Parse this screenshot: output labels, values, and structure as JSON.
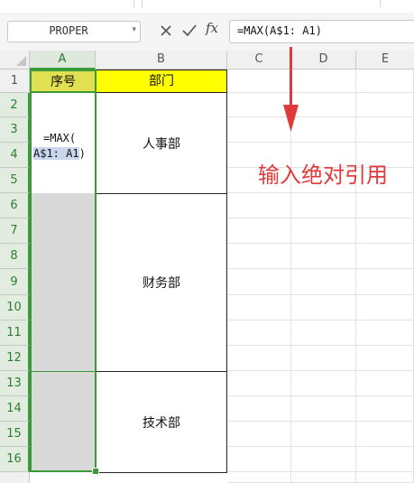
{
  "formula_bar": {
    "name_box": "PROPER",
    "name_box_arrow": "▾",
    "cancel_icon": "close-icon",
    "enter_icon": "check-icon",
    "fx_label": "fx",
    "formula": "=MAX(A$1: A1)"
  },
  "columns": [
    "A",
    "B",
    "C",
    "D",
    "E"
  ],
  "rows": [
    "1",
    "2",
    "3",
    "4",
    "5",
    "6",
    "7",
    "8",
    "9",
    "10",
    "11",
    "12",
    "13",
    "14",
    "15",
    "16"
  ],
  "sheet": {
    "a1": "序号",
    "b1": "部门",
    "edit_line1": "=MAX(",
    "edit_ref": "A$1: A1",
    "edit_close": ")",
    "dept1": "人事部",
    "dept2": "财务部",
    "dept3": "技术部"
  },
  "annotation": {
    "text": "输入绝对引用",
    "color": "#e23a3a"
  },
  "colors": {
    "header_fill": "#ffff00",
    "selection": "#3a9a3a",
    "merged_gray": "#d9d9d9"
  }
}
